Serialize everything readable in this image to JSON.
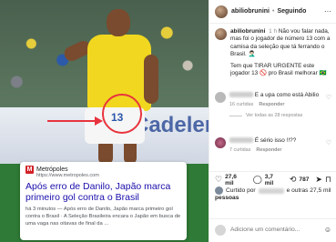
{
  "photo": {
    "ad_text": "Cadeler",
    "shorts_number": "13"
  },
  "news": {
    "source_name": "Metrópoles",
    "source_url": "https://www.metropoles.com",
    "title": "Após erro de Danilo, Japão marca primeiro gol contra o Brasil",
    "snippet": "há 3 minutos — Após erro de Danilo, Japão marca primeiro gol contra o Brasil · A Seleção Brasileira encara o Japão em busca de uma vaga nas oitavas de final da ..."
  },
  "header": {
    "username": "abiliobrunini",
    "separator": "•",
    "follow_label": "Seguindo",
    "more_label": "···"
  },
  "caption": {
    "username": "abiliobrunini",
    "time": "1 h",
    "text": "Não vou falar nada, mas foi o jogador de número 13 com a camisa da seleção que tá ferrando o Brasil. 🤦🏻‍♂️",
    "text2": "Tem que TIRAR URGENTE este jogador 13 🚫 pro Brasil melhorar 🇧🇷"
  },
  "comments": [
    {
      "text": "E a upa como está Abilio",
      "likes": "16 curtidas",
      "reply": "Responder",
      "view_replies": "Ver todas as 28 respostas"
    },
    {
      "text": "É sério isso !!??",
      "likes": "7 curtidas",
      "reply": "Responder"
    }
  ],
  "actions": {
    "likes_count": "27,6 mil",
    "comments_count": "3,7 mil",
    "shares_count": "787"
  },
  "liked_by": {
    "line1": "Curtido por",
    "line1b": "e outras 27,5 mil",
    "line2": "pessoas"
  },
  "add_comment": {
    "placeholder": "Adicione um comentário..."
  }
}
